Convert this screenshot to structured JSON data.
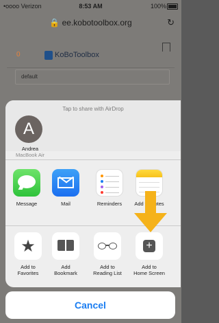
{
  "status_bar": {
    "carrier": "•oooo Verizon",
    "time": "8:53 AM",
    "battery": "100%"
  },
  "browser": {
    "url": "ee.kobotoolbox.org",
    "reload_icon": "reload-icon"
  },
  "website": {
    "count": "0",
    "logo_text": "KoBoToolbox",
    "field_value": "default"
  },
  "share_sheet": {
    "airdrop_title": "Tap to share with AirDrop",
    "device": {
      "initial": "A",
      "name": "Andrea",
      "type": "MacBook Air"
    },
    "apps": [
      {
        "label": "Message",
        "icon": "messages-icon"
      },
      {
        "label": "Mail",
        "icon": "mail-icon"
      },
      {
        "label": "Reminders",
        "icon": "reminders-icon"
      },
      {
        "label": "Add to Notes",
        "icon": "notes-icon"
      }
    ],
    "actions": [
      {
        "line1": "Add to",
        "line2": "Favorites",
        "icon": "star-icon"
      },
      {
        "line1": "Add",
        "line2": "Bookmark",
        "icon": "book-icon"
      },
      {
        "line1": "Add to",
        "line2": "Reading List",
        "icon": "glasses-icon"
      },
      {
        "line1": "Add to",
        "line2": "Home Screen",
        "icon": "add-square-icon"
      }
    ],
    "cancel_label": "Cancel"
  },
  "colors": {
    "accent": "#1a7df1",
    "arrow": "#f5b21a"
  }
}
